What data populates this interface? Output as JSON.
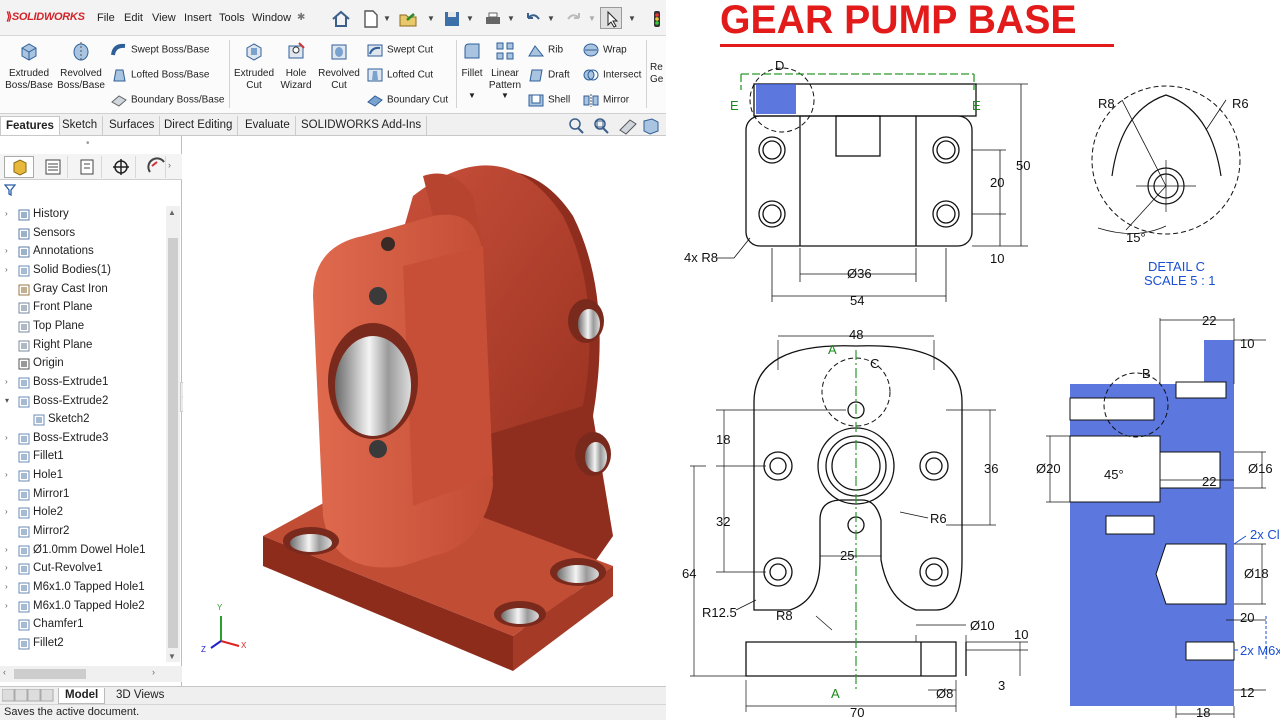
{
  "app": {
    "brand": "SOLIDWORKS",
    "menus": [
      "File",
      "Edit",
      "View",
      "Insert",
      "Tools",
      "Window"
    ],
    "pin_icon": "pin-icon"
  },
  "commands": {
    "extruded_boss": "Extruded\nBoss/Base",
    "revolved_boss": "Revolved\nBoss/Base",
    "swept_boss": "Swept Boss/Base",
    "lofted_boss": "Lofted Boss/Base",
    "boundary_boss": "Boundary Boss/Base",
    "extruded_cut": "Extruded\nCut",
    "hole_wizard": "Hole\nWizard",
    "revolved_cut": "Revolved\nCut",
    "swept_cut": "Swept Cut",
    "lofted_cut": "Lofted Cut",
    "boundary_cut": "Boundary Cut",
    "fillet": "Fillet",
    "linear_pattern": "Linear\nPattern",
    "rib": "Rib",
    "draft": "Draft",
    "shell": "Shell",
    "wrap": "Wrap",
    "intersect": "Intersect",
    "mirror": "Mirror",
    "ref_geo": "Re\nGe"
  },
  "tabs": [
    "Features",
    "Sketch",
    "Surfaces",
    "Direct Editing",
    "Evaluate",
    "SOLIDWORKS Add-Ins"
  ],
  "tree": [
    {
      "label": "History",
      "arrow": true,
      "icon": "history-icon"
    },
    {
      "label": "Sensors",
      "arrow": false,
      "icon": "sensor-icon"
    },
    {
      "label": "Annotations",
      "arrow": true,
      "icon": "annotation-icon"
    },
    {
      "label": "Solid Bodies(1)",
      "arrow": true,
      "icon": "solid-bodies-icon"
    },
    {
      "label": "Gray Cast Iron",
      "arrow": false,
      "icon": "material-icon"
    },
    {
      "label": "Front Plane",
      "arrow": false,
      "icon": "plane-icon"
    },
    {
      "label": "Top Plane",
      "arrow": false,
      "icon": "plane-icon"
    },
    {
      "label": "Right Plane",
      "arrow": false,
      "icon": "plane-icon"
    },
    {
      "label": "Origin",
      "arrow": false,
      "icon": "origin-icon"
    },
    {
      "label": "Boss-Extrude1",
      "arrow": true,
      "icon": "extrude-icon"
    },
    {
      "label": "Boss-Extrude2",
      "arrow": true,
      "icon": "extrude-icon",
      "expanded": true
    },
    {
      "label": "Sketch2",
      "arrow": false,
      "icon": "sketch-icon",
      "indent": true
    },
    {
      "label": "Boss-Extrude3",
      "arrow": true,
      "icon": "extrude-icon"
    },
    {
      "label": "Fillet1",
      "arrow": false,
      "icon": "fillet-icon"
    },
    {
      "label": "Hole1",
      "arrow": true,
      "icon": "hole-icon"
    },
    {
      "label": "Mirror1",
      "arrow": false,
      "icon": "mirror-icon"
    },
    {
      "label": "Hole2",
      "arrow": true,
      "icon": "hole-icon"
    },
    {
      "label": "Mirror2",
      "arrow": false,
      "icon": "mirror-icon"
    },
    {
      "label": "Ø1.0mm Dowel Hole1",
      "arrow": true,
      "icon": "hole-icon"
    },
    {
      "label": "Cut-Revolve1",
      "arrow": true,
      "icon": "revolve-icon"
    },
    {
      "label": "M6x1.0 Tapped Hole1",
      "arrow": true,
      "icon": "hole-icon"
    },
    {
      "label": "M6x1.0 Tapped Hole2",
      "arrow": true,
      "icon": "hole-icon"
    },
    {
      "label": "Chamfer1",
      "arrow": false,
      "icon": "chamfer-icon"
    },
    {
      "label": "Fillet2",
      "arrow": false,
      "icon": "fillet-icon"
    }
  ],
  "bottom_tabs": [
    "Model",
    "3D Views"
  ],
  "status_text": "Saves the active document.",
  "triad": {
    "x": "X",
    "y": "Y",
    "z": "Z"
  },
  "drawing": {
    "title": "GEAR PUMP BASE",
    "detail_label": "DETAIL  C",
    "detail_scale": "SCALE 5 : 1",
    "labels": {
      "D": "D",
      "E": "E",
      "A": "A",
      "B": "B",
      "C": "C",
      "r8_top": "R8",
      "r6_top": "R6",
      "angle15": "15°",
      "d50": "50",
      "d20": "20",
      "d10": "10",
      "r8x4": "4x R8",
      "phi36": "Ø36",
      "d54": "54",
      "d48": "48",
      "d18": "18",
      "d36": "36",
      "d32": "32",
      "d64": "64",
      "r6": "R6",
      "d25": "25",
      "r125": "R12.5",
      "r8": "R8",
      "phi10": "Ø10",
      "d10b": "10",
      "d3": "3",
      "phi8": "Ø8",
      "d70": "70",
      "d22a": "22",
      "d10c": "10",
      "phi20": "Ø20",
      "angle45": "45°",
      "d22b": "22",
      "phi16": "Ø16",
      "chamfer": "2x Cl",
      "phi18": "Ø18",
      "d20b": "20",
      "m6": "2x M6x",
      "d12": "12",
      "d18b": "18"
    }
  }
}
